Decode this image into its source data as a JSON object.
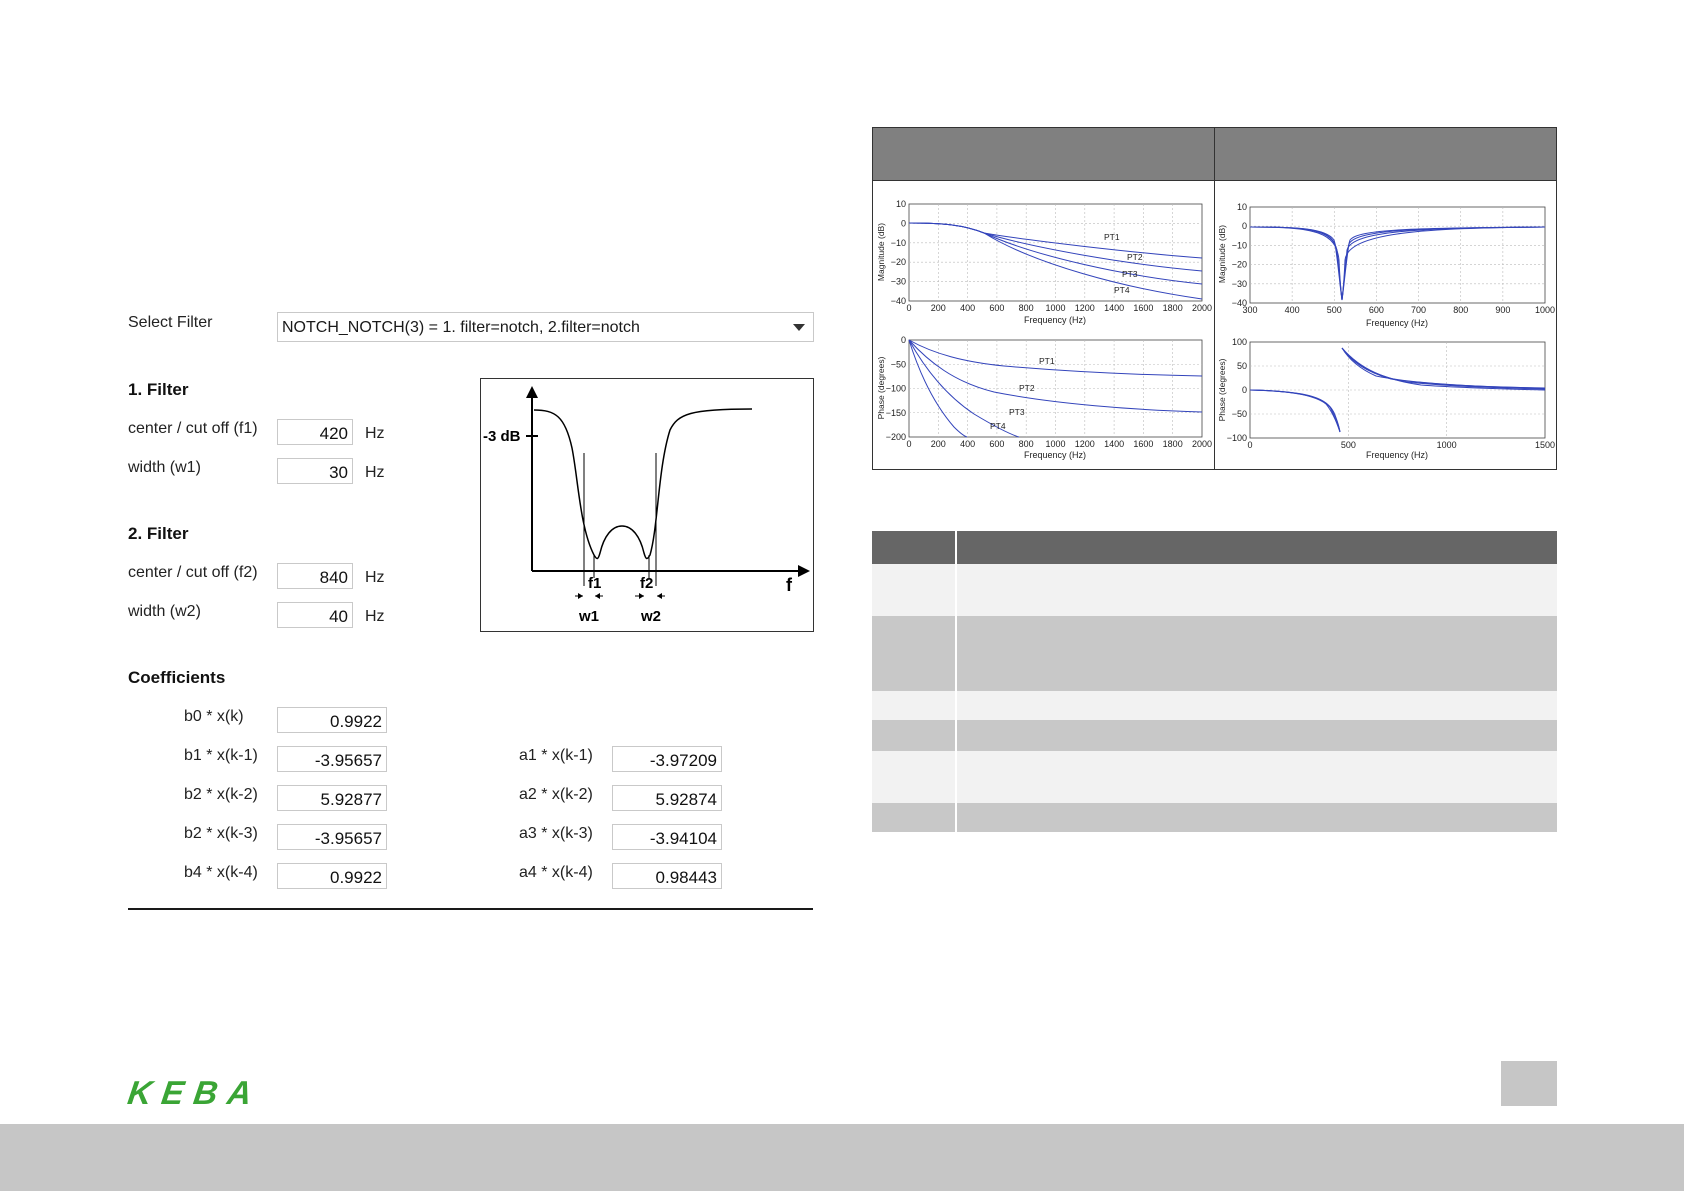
{
  "filter_ui": {
    "select_label": "Select Filter",
    "select_value": "NOTCH_NOTCH(3) = 1. filter=notch, 2.filter=notch",
    "filter1": {
      "heading": "1. Filter",
      "center_label": "center / cut off (f1)",
      "center_value": "420",
      "width_label": "width (w1)",
      "width_value": "30",
      "unit": "Hz"
    },
    "filter2": {
      "heading": "2. Filter",
      "center_label": "center / cut off (f2)",
      "center_value": "840",
      "width_label": "width (w2)",
      "width_value": "40",
      "unit": "Hz"
    },
    "coefficients": {
      "heading": "Coefficients",
      "b": [
        {
          "label": "b0 * x(k)",
          "value": "0.9922"
        },
        {
          "label": "b1 * x(k-1)",
          "value": "-3.95657"
        },
        {
          "label": "b2 * x(k-2)",
          "value": "5.92877"
        },
        {
          "label": "b2 * x(k-3)",
          "value": "-3.95657"
        },
        {
          "label": "b4 * x(k-4)",
          "value": "0.9922"
        }
      ],
      "a": [
        {
          "label": "a1 * x(k-1)",
          "value": "-3.97209"
        },
        {
          "label": "a2 * x(k-2)",
          "value": "5.92874"
        },
        {
          "label": "a3 * x(k-3)",
          "value": "-3.94104"
        },
        {
          "label": "a4 * x(k-4)",
          "value": "0.98443"
        }
      ]
    },
    "diagram": {
      "db_label": "-3 dB",
      "f_axis": "f",
      "f1": "f1",
      "f2": "f2",
      "w1": "w1",
      "w2": "w2"
    }
  },
  "plots": {
    "magnitude_ylabel": "Magnitude (dB)",
    "phase_ylabel": "Phase (degrees)",
    "xlabel": "Frequency (Hz)",
    "lowpass_series": [
      "PT1",
      "PT2",
      "PT3",
      "PT4"
    ],
    "lowpass_mag_yticks": [
      "10",
      "0",
      "−10",
      "−20",
      "−30",
      "−40"
    ],
    "lowpass_xticks": [
      "0",
      "200",
      "400",
      "600",
      "800",
      "1000",
      "1200",
      "1400",
      "1600",
      "1800",
      "2000"
    ],
    "lowpass_phase_yticks": [
      "0",
      "−50",
      "−100",
      "−150",
      "−200"
    ],
    "notch_mag_yticks": [
      "10",
      "0",
      "−10",
      "−20",
      "−30",
      "−40"
    ],
    "notch_mag_xticks": [
      "300",
      "400",
      "500",
      "600",
      "700",
      "800",
      "900",
      "1000"
    ],
    "notch_phase_yticks": [
      "100",
      "50",
      "0",
      "−50",
      "−100"
    ],
    "notch_phase_xticks": [
      "0",
      "500",
      "1000",
      "1500"
    ]
  },
  "colors": {
    "curve": "#3344bb",
    "logo": "#3aa535",
    "table_header": "#666666",
    "table_light": "#f2f2f2",
    "table_dark": "#c8c8c8"
  },
  "brand": {
    "logo_text": "KEBA"
  }
}
